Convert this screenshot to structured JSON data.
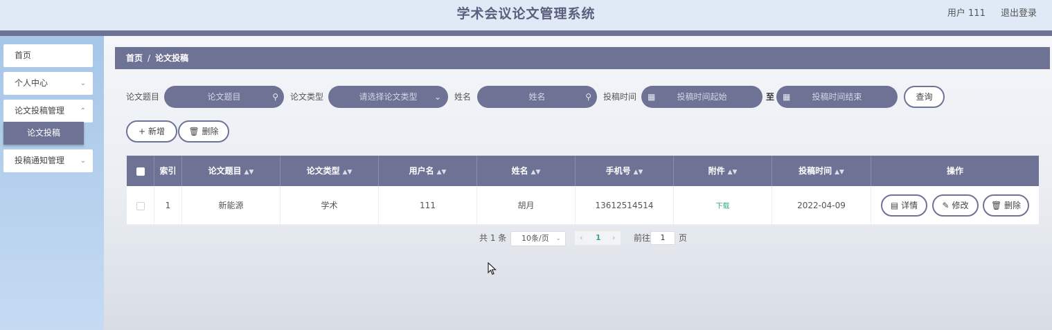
{
  "app": {
    "title": "学术会议论文管理系统"
  },
  "user": {
    "label": "用户 111",
    "logout": "退出登录"
  },
  "sidebar": {
    "items": [
      {
        "label": "首页"
      },
      {
        "label": "个人中心"
      },
      {
        "label": "论文投稿管理"
      },
      {
        "label": "投稿通知管理"
      }
    ],
    "sub_active": "论文投稿"
  },
  "breadcrumb": {
    "home": "首页",
    "sep": "/",
    "current": "论文投稿"
  },
  "search": {
    "title_label": "论文题目",
    "title_placeholder": "论文题目",
    "type_label": "论文类型",
    "type_placeholder": "请选择论文类型",
    "name_label": "姓名",
    "name_placeholder": "姓名",
    "time_label": "投稿时间",
    "time_start_placeholder": "投稿时间起始",
    "to_label": "至",
    "time_end_placeholder": "投稿时间结束",
    "query_button": "查询"
  },
  "actions": {
    "add": "新增",
    "delete": "删除"
  },
  "table": {
    "headers": [
      "索引",
      "论文题目",
      "论文类型",
      "用户名",
      "姓名",
      "手机号",
      "附件",
      "投稿时间",
      "操作"
    ],
    "rows": [
      {
        "index": "1",
        "title": "新能源",
        "type": "学术",
        "username": "111",
        "name": "胡月",
        "phone": "13612514514",
        "attachment": "下载",
        "time": "2022-04-09",
        "ops": {
          "detail": "详情",
          "edit": "修改",
          "delete": "删除"
        }
      }
    ]
  },
  "pagination": {
    "total": "共 1 条",
    "page_size": "10条/页",
    "current": "1",
    "goto_prefix": "前往",
    "goto_value": "1",
    "goto_suffix": "页"
  },
  "colors": {
    "accent": "#6e7295",
    "sidebar": "#b8d2ee",
    "link": "#3aa887"
  }
}
